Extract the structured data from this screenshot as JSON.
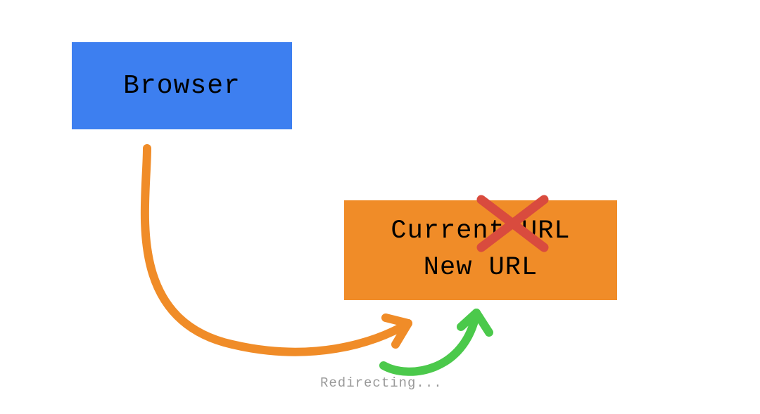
{
  "browser": {
    "label": "Browser",
    "color": "#3d7ff0"
  },
  "urlBox": {
    "line1": "Current URL",
    "line2": "New URL",
    "color": "#f08c28"
  },
  "redirecting": {
    "label": "Redirecting..."
  },
  "arrows": {
    "orange": {
      "color": "#f08c28",
      "description": "browser-to-url-arrow"
    },
    "green": {
      "color": "#4bc94b",
      "description": "redirect-arrow"
    }
  },
  "cross": {
    "color": "#d94b3e",
    "description": "strikethrough-current-url"
  }
}
